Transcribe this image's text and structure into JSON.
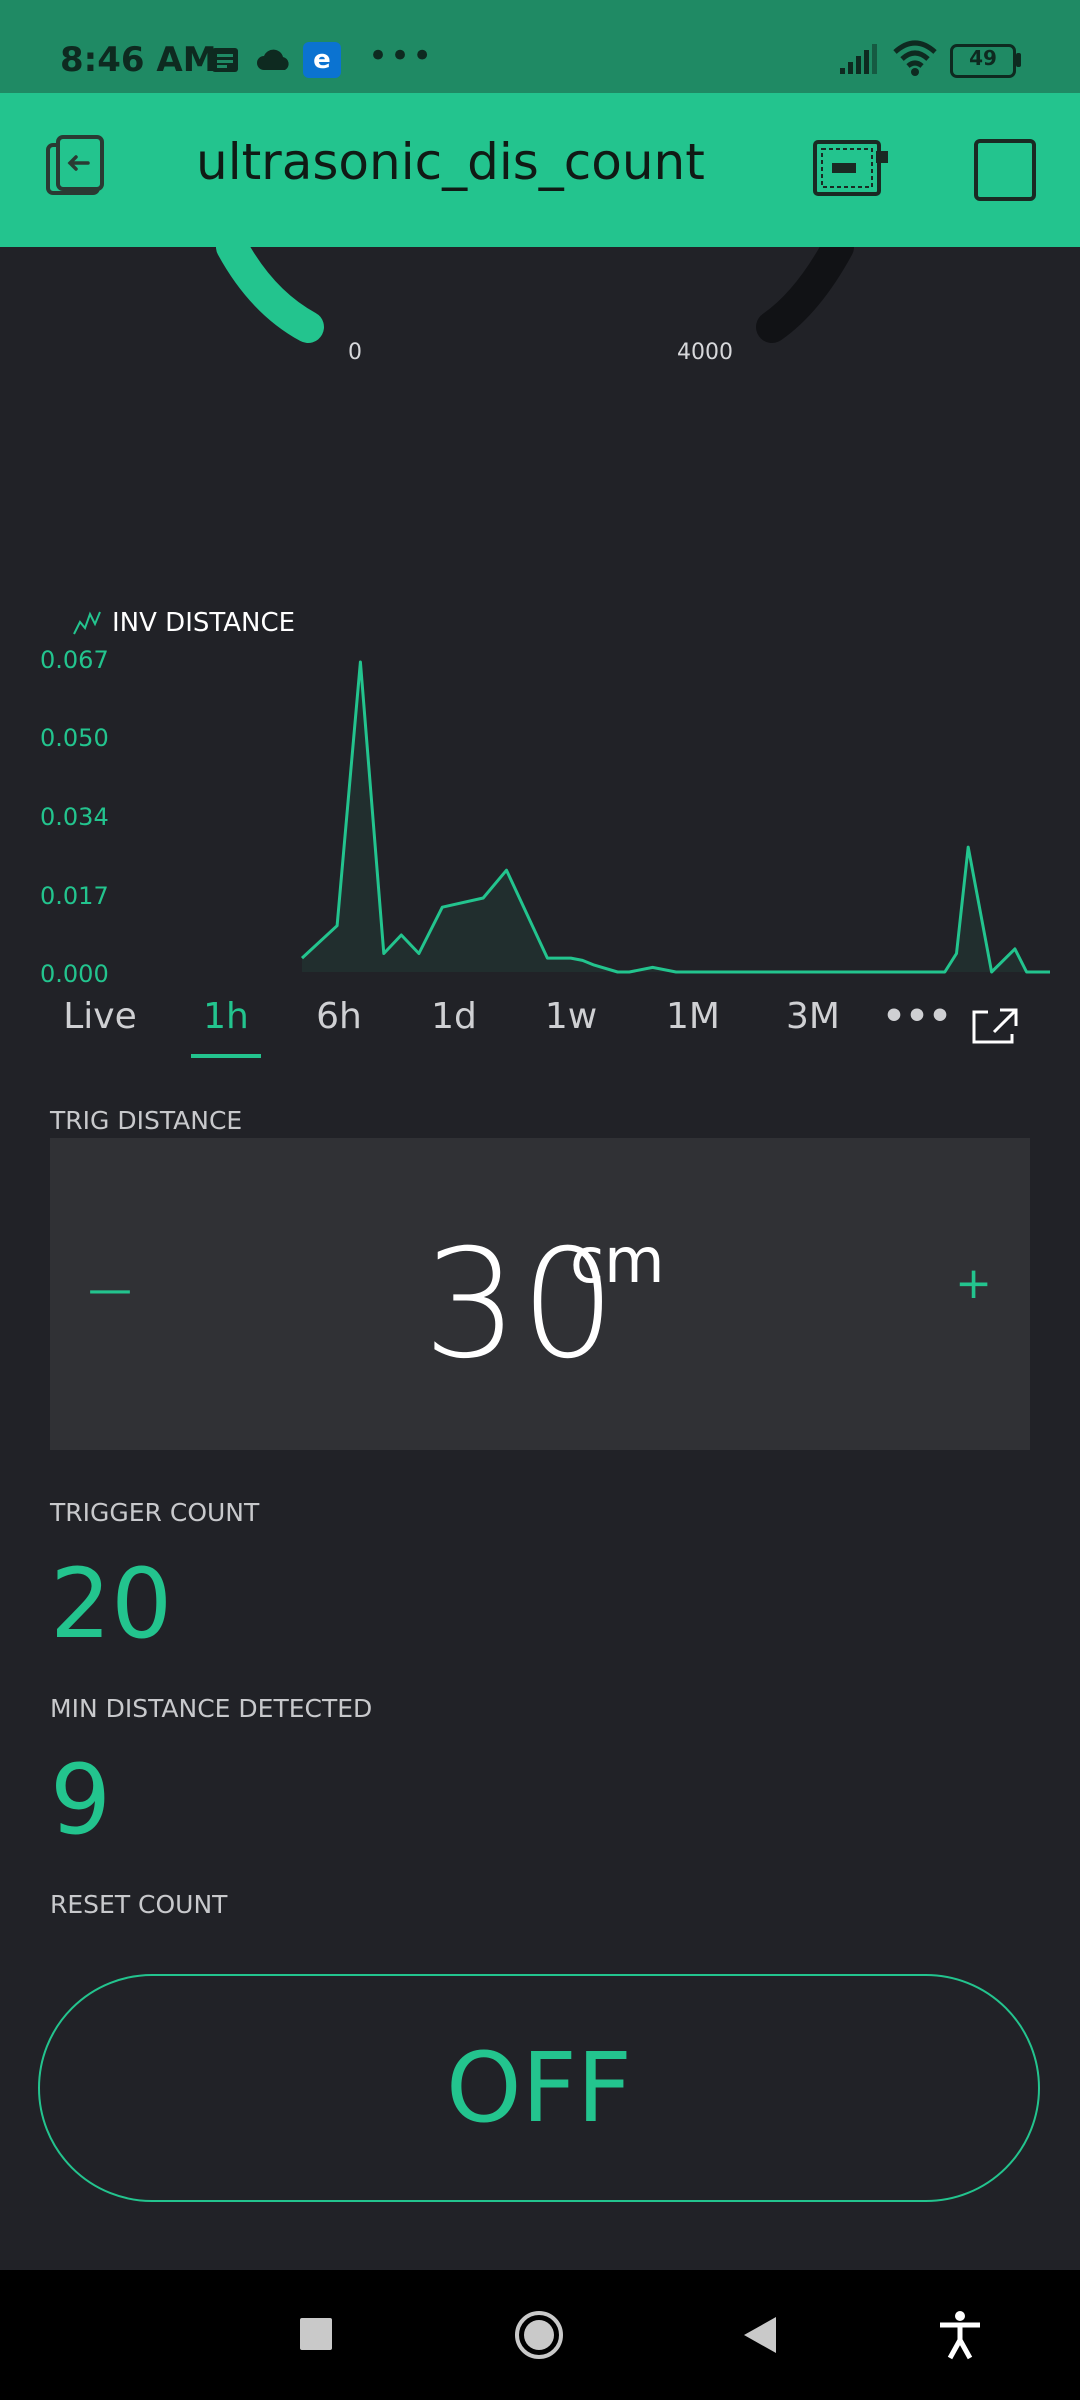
{
  "status_bar": {
    "time": "8:46 AM",
    "battery": "49",
    "icons": [
      "news-icon",
      "cloud-icon",
      "edge-icon",
      "more-icon",
      "signal-icon",
      "wifi-icon",
      "battery-icon"
    ],
    "edge_letter": "e",
    "more": "•••"
  },
  "app_bar": {
    "title": "ultrasonic_dis_count",
    "left_icon": "exit-icon",
    "right_icons": [
      "device-icon",
      "square-icon"
    ]
  },
  "gauge": {
    "min_label": "0",
    "max_label": "4000"
  },
  "chart_data": {
    "type": "area",
    "title": "INV DISTANCE",
    "y_ticks": [
      "0.067",
      "0.050",
      "0.034",
      "0.017",
      "0.000"
    ],
    "ylim": [
      0,
      0.067
    ],
    "x": [
      0,
      3,
      5,
      7,
      8.5,
      10,
      12,
      15.5,
      17.5,
      21,
      23,
      24,
      25,
      27,
      28,
      30,
      32,
      34,
      35,
      38,
      40,
      45,
      50,
      55,
      56,
      57,
      59,
      61,
      62,
      64
    ],
    "y": [
      0.003,
      0.01,
      0.067,
      0.004,
      0.008,
      0.004,
      0.014,
      0.016,
      0.022,
      0.003,
      0.003,
      0.0025,
      0.0015,
      0.0,
      0.0,
      0.001,
      0.0,
      0.0,
      0.0,
      0.0,
      0.0,
      0.0,
      0.0,
      0.0,
      0.004,
      0.027,
      0.0,
      0.005,
      0.0,
      0.0
    ],
    "color": "#23c48e"
  },
  "periods": {
    "items": [
      "Live",
      "1h",
      "6h",
      "1d",
      "1w",
      "1M",
      "3M"
    ],
    "active": "1h",
    "more": "•••"
  },
  "trig_distance": {
    "label": "TRIG DISTANCE",
    "value": "30",
    "unit": "cm",
    "minus": "—",
    "plus": "+"
  },
  "trigger_count": {
    "label": "TRIGGER COUNT",
    "value": "20"
  },
  "min_distance": {
    "label": "MIN DISTANCE DETECTED",
    "value": "9"
  },
  "reset_count": {
    "label": "RESET COUNT",
    "button_label": "OFF"
  },
  "nav_bar": {
    "icons": [
      "recents-icon",
      "home-icon",
      "back-icon",
      "accessibility-icon"
    ]
  },
  "colors": {
    "accent": "#23c48e",
    "header": "#23c48e",
    "status_bar": "#1f8a64",
    "background": "#212227",
    "panel": "#303135"
  }
}
